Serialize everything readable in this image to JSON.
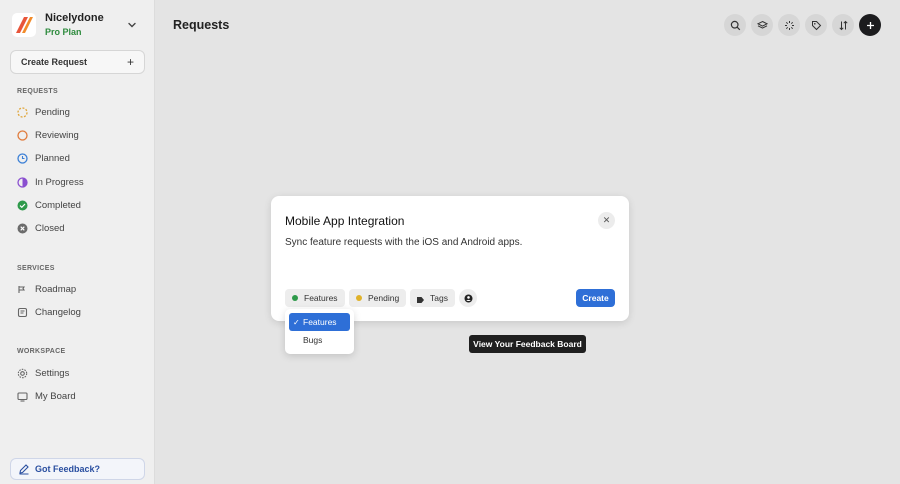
{
  "workspace": {
    "name": "Nicelydone",
    "plan": "Pro Plan"
  },
  "sidebar": {
    "create_label": "Create Request",
    "sections": {
      "requests": "REQUESTS",
      "services": "SERVICES",
      "workspace": "WORKSPACE"
    },
    "requests_items": [
      {
        "label": "Pending",
        "icon": "pending-status-icon",
        "color": "#e0a63a"
      },
      {
        "label": "Reviewing",
        "icon": "reviewing-status-icon",
        "color": "#e07a3a"
      },
      {
        "label": "Planned",
        "icon": "planned-status-icon",
        "color": "#3a7fd6"
      },
      {
        "label": "In Progress",
        "icon": "in-progress-status-icon",
        "color": "#8a4fd0"
      },
      {
        "label": "Completed",
        "icon": "completed-status-icon",
        "color": "#2e9a4a"
      },
      {
        "label": "Closed",
        "icon": "closed-status-icon",
        "color": "#6b6b6b"
      }
    ],
    "services_items": [
      {
        "label": "Roadmap",
        "icon": "roadmap-icon"
      },
      {
        "label": "Changelog",
        "icon": "changelog-icon"
      }
    ],
    "workspace_items": [
      {
        "label": "Settings",
        "icon": "gear-icon"
      },
      {
        "label": "My Board",
        "icon": "board-icon"
      }
    ],
    "feedback_label": "Got Feedback?"
  },
  "header": {
    "title": "Requests"
  },
  "modal": {
    "title": "Mobile App Integration",
    "description": "Sync feature requests with the iOS and Android apps.",
    "board_chip": "Features",
    "status_chip": "Pending",
    "tags_chip": "Tags",
    "submit_label": "Create"
  },
  "dropdown": {
    "options": [
      "Features",
      "Bugs"
    ],
    "selected": "Features"
  },
  "tooltip": {
    "text": "View Your Feedback Board"
  },
  "colors": {
    "accent": "#2e6fd7",
    "plan_green": "#2e8b3e",
    "features_dot": "#2e9a4a",
    "pending_dot": "#e0b22a"
  }
}
